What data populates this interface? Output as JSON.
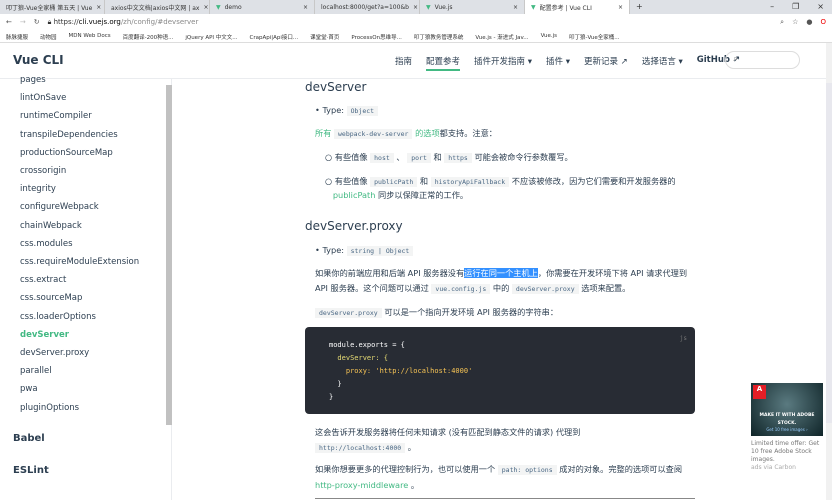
{
  "browser": {
    "tabs": [
      {
        "label": "叩丁狼-Vue全家桶 第五天 | Vue"
      },
      {
        "label": "axios中文文档|axios中文网 | ax"
      },
      {
        "label": "demo"
      },
      {
        "label": "localhost:8000/get?a=100&b"
      },
      {
        "label": "Vue.js"
      },
      {
        "label": "配置参考 | Vue CLI",
        "active": true
      }
    ],
    "url_prefix": "https://",
    "url_host": "cli.vuejs.org",
    "url_path": "/zh/config/#devserver",
    "bookmarks": [
      "脉脉捷服",
      "动物园",
      "MDN Web Docs",
      "百度翻译-200种语...",
      "jQuery API 中文文...",
      "CrapApi|Api接口...",
      "课堂堂·首页",
      "ProcessOn思维导...",
      "叩丁狼教务管理系统",
      "Vue.js - 渐进式 Jav...",
      "Vue.js",
      "叩丁狼-Vue全家桶..."
    ]
  },
  "header": {
    "logo": "Vue CLI",
    "nav": [
      "指南",
      "配置参考",
      "插件开发指南 ▾",
      "插件 ▾",
      "更新记录 ↗",
      "选择语言 ▾",
      "GitHub ↗"
    ],
    "search_icon": "⌕"
  },
  "sidebar": {
    "items": [
      "pages",
      "lintOnSave",
      "runtimeCompiler",
      "transpileDependencies",
      "productionSourceMap",
      "crossorigin",
      "integrity",
      "configureWebpack",
      "chainWebpack",
      "css.modules",
      "css.requireModuleExtension",
      "css.extract",
      "css.sourceMap",
      "css.loaderOptions",
      "devServer",
      "devServer.proxy",
      "parallel",
      "pwa",
      "pluginOptions"
    ],
    "active": "devServer",
    "groups": [
      "Babel",
      "ESLint"
    ]
  },
  "content": {
    "h_devserver": "devServer",
    "type_label": "Type:",
    "type_object": "Object",
    "all_a": "所有",
    "all_code": "webpack-dev-server",
    "all_b": "的选项",
    "all_c": "都支持。注意：",
    "b1_a": "有些值像",
    "b1_host": "host",
    "b1_sep": "、",
    "b1_port": "port",
    "b1_and": "和",
    "b1_https": "https",
    "b1_b": "可能会被命令行参数覆写。",
    "b2_a": "有些值像",
    "b2_pp": "publicPath",
    "b2_and": "和",
    "b2_haf": "historyApiFallback",
    "b2_b": "不应该被修改，因为它们需要和开发服务器的",
    "b2_link": "publicPath",
    "b2_c": "同步以保障正常的工作。",
    "h_proxy": "devServer.proxy",
    "type_proxy": "string | Object",
    "p1_a": "如果你的前端应用和后端 API 服务器没有",
    "p1_hl": "运行在同一个主机上",
    "p1_b": "，你需要在开发环境下将 API 请求代理到 API 服务器。这个问题可以通过",
    "p1_code1": "vue.config.js",
    "p1_c": "中的",
    "p1_code2": "devServer.proxy",
    "p1_d": "选项来配置。",
    "p2_code": "devServer.proxy",
    "p2_text": "可以是一个指向开发环境 API 服务器的字符串：",
    "code_lang": "js",
    "code_lines": [
      "module.exports = {",
      "  devServer: {",
      "    proxy: 'http://localhost:4000'",
      "  }",
      "}"
    ],
    "p3_text": "这会告诉开发服务器将任何未知请求 (没有匹配到静态文件的请求) 代理到",
    "p3_code": "http://localhost:4000",
    "p3_end": "。",
    "p4_a": "如果你想要更多的代理控制行为，也可以使用一个",
    "p4_code": "path: options",
    "p4_b": "成对的对象。完整的选项可以查阅",
    "p4_link": "http-proxy-middleware",
    "p4_end": "。"
  },
  "ad": {
    "text": "Limited time offer: Get 10 free Adobe Stock images.",
    "via": "ads via Carbon",
    "image_text": "MAKE IT WITH ADOBE STOCK.",
    "image_sub": "Get 10 free images ›"
  }
}
